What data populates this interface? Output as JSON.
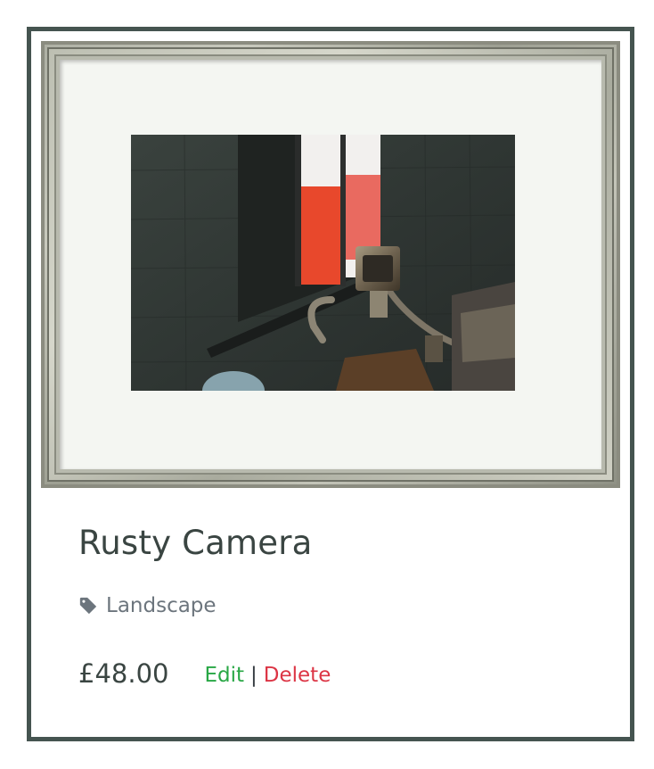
{
  "product": {
    "title": "Rusty Camera",
    "category": "Landscape",
    "price": "£48.00",
    "image_alt": "Rusty security camera mounted on a dark green wall below a window"
  },
  "actions": {
    "edit_label": "Edit",
    "separator": "|",
    "delete_label": "Delete"
  },
  "icons": {
    "category": "tag-icon"
  },
  "colors": {
    "card_border": "#455450",
    "title": "#3a4542",
    "category": "#6c757d",
    "edit": "#28a745",
    "delete": "#dc3545",
    "mat": "#f4f6f2"
  }
}
